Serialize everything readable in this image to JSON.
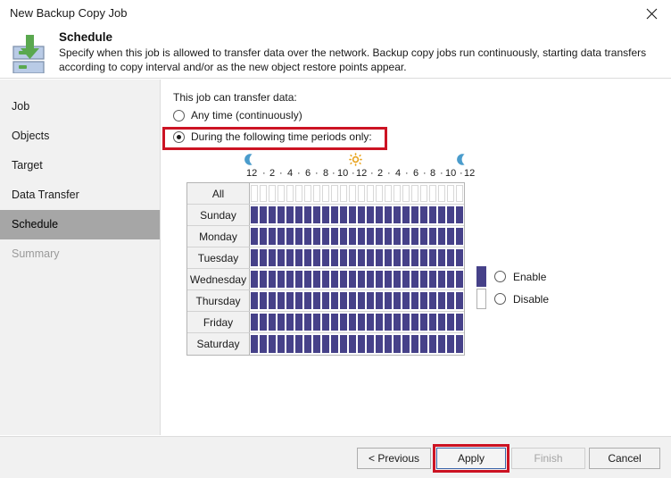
{
  "window": {
    "title": "New Backup Copy Job",
    "close_icon": "close-icon"
  },
  "header": {
    "icon": "backup-copy-job-icon",
    "title": "Schedule",
    "description": "Specify when this job is allowed to transfer data over the network. Backup copy jobs run continuously, starting data transfers according to copy interval and/or as the new object restore points appear."
  },
  "sidebar": {
    "items": [
      {
        "label": "Job",
        "state": "normal"
      },
      {
        "label": "Objects",
        "state": "normal"
      },
      {
        "label": "Target",
        "state": "normal"
      },
      {
        "label": "Data Transfer",
        "state": "normal"
      },
      {
        "label": "Schedule",
        "state": "selected"
      },
      {
        "label": "Summary",
        "state": "disabled"
      }
    ]
  },
  "main": {
    "lead_label": "This job can transfer data:",
    "options": [
      {
        "label": "Any time (continuously)",
        "selected": false
      },
      {
        "label": "During the following time periods only:",
        "selected": true
      }
    ],
    "schedule": {
      "night_icon_left": "moon-icon",
      "day_icon": "sun-icon",
      "night_icon_right": "moon-icon",
      "hour_labels": [
        "12",
        "2",
        "4",
        "6",
        "8",
        "10",
        "12",
        "2",
        "4",
        "6",
        "8",
        "10",
        "12"
      ],
      "all_row_label": "All",
      "days": [
        {
          "label": "Sunday",
          "hours_enabled": 24
        },
        {
          "label": "Monday",
          "hours_enabled": 24
        },
        {
          "label": "Tuesday",
          "hours_enabled": 24
        },
        {
          "label": "Wednesday",
          "hours_enabled": 24
        },
        {
          "label": "Thursday",
          "hours_enabled": 24
        },
        {
          "label": "Friday",
          "hours_enabled": 24
        },
        {
          "label": "Saturday",
          "hours_enabled": 24
        }
      ]
    },
    "legend": [
      {
        "label": "Enable",
        "swatch": "filled",
        "selected": false
      },
      {
        "label": "Disable",
        "swatch": "empty",
        "selected": false
      }
    ]
  },
  "footer": {
    "buttons": [
      {
        "label": "< Previous",
        "state": "normal"
      },
      {
        "label": "Apply",
        "state": "focused"
      },
      {
        "label": "Finish",
        "state": "disabled"
      },
      {
        "label": "Cancel",
        "state": "normal"
      }
    ]
  },
  "colors": {
    "enabled_cell": "#464189",
    "highlight_box": "#cc1323",
    "sidebar_selected": "#a6a6a6",
    "sun": "#e8a21c",
    "moon": "#4a9ccc",
    "icon_green": "#5aa84f"
  }
}
